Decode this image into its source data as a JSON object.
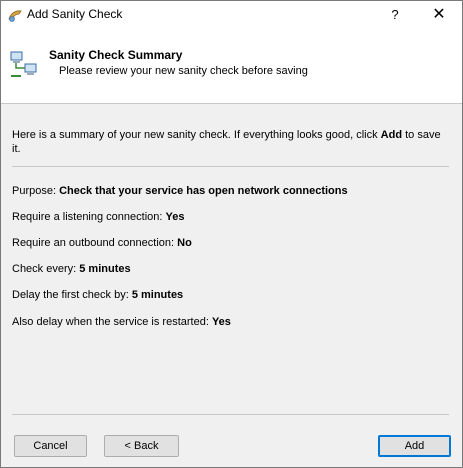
{
  "window": {
    "title": "Add Sanity Check",
    "help_label": "?",
    "close_label": "✕"
  },
  "header": {
    "title": "Sanity Check Summary",
    "subtitle": "Please review your new sanity check before saving"
  },
  "intro": {
    "text_before": "Here is a summary of your new sanity check. If everything looks good, click ",
    "action": "Add",
    "text_after": " to save it."
  },
  "summary": {
    "purpose_label": "Purpose: ",
    "purpose_value": "Check that your service has open network connections",
    "listening_label": "Require a listening connection: ",
    "listening_value": "Yes",
    "outbound_label": "Require an outbound connection: ",
    "outbound_value": "No",
    "every_label": "Check every: ",
    "every_value": "5 minutes",
    "delay_label": "Delay the first check by: ",
    "delay_value": "5 minutes",
    "restart_label": "Also delay when the service is restarted: ",
    "restart_value": "Yes"
  },
  "buttons": {
    "cancel": "Cancel",
    "back": "< Back",
    "add": "Add"
  }
}
